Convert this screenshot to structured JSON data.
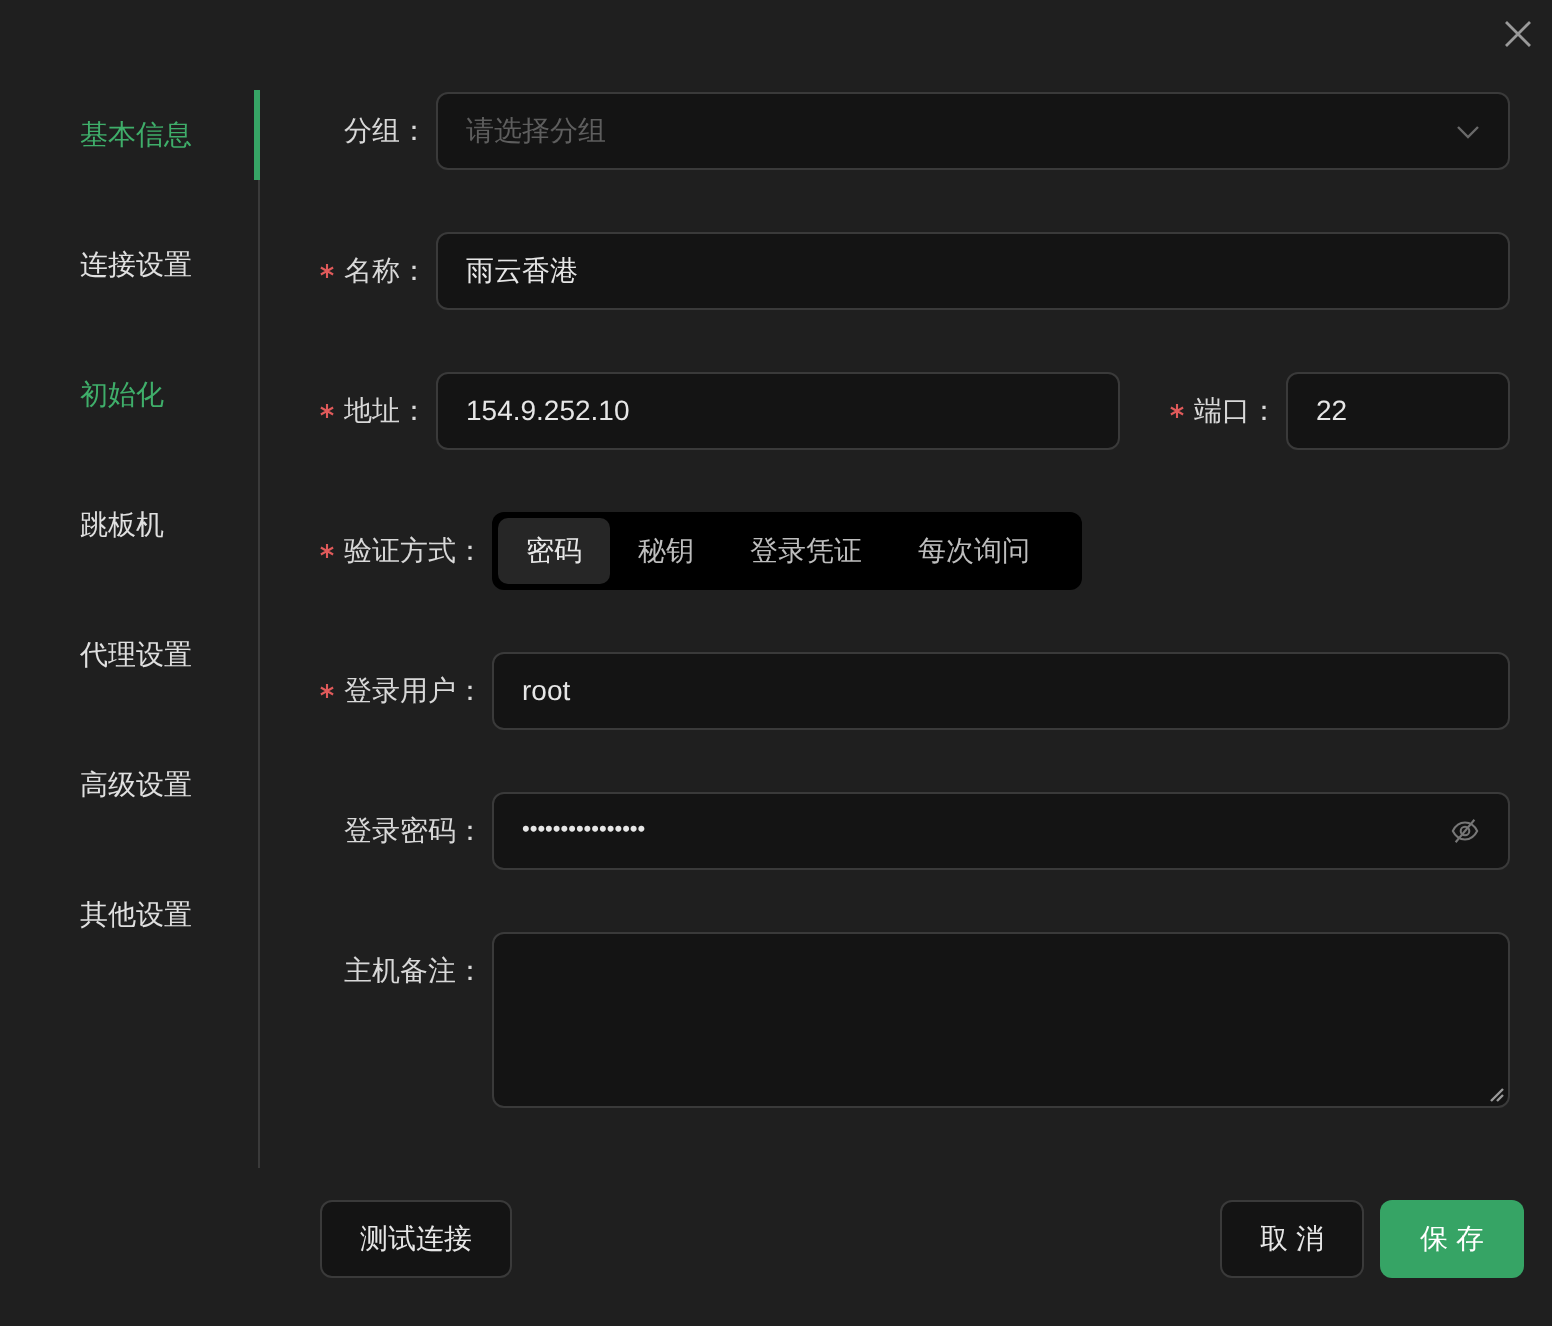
{
  "sidebar": {
    "items": [
      {
        "label": "基本信息",
        "selected": true,
        "highlighted": true
      },
      {
        "label": "连接设置",
        "selected": false,
        "highlighted": false
      },
      {
        "label": "初始化",
        "selected": false,
        "highlighted": true
      },
      {
        "label": "跳板机",
        "selected": false,
        "highlighted": false
      },
      {
        "label": "代理设置",
        "selected": false,
        "highlighted": false
      },
      {
        "label": "高级设置",
        "selected": false,
        "highlighted": false
      },
      {
        "label": "其他设置",
        "selected": false,
        "highlighted": false
      }
    ]
  },
  "form": {
    "rows": [
      {
        "fields": [
          {
            "kind": "select",
            "label": "分组：",
            "required": false,
            "placeholder": "请选择分组"
          }
        ]
      },
      {
        "fields": [
          {
            "kind": "text",
            "label": "名称：",
            "required": true,
            "value": "雨云香港"
          }
        ]
      },
      {
        "fields": [
          {
            "kind": "text",
            "label": "地址：",
            "required": true,
            "value": "154.9.252.10"
          },
          {
            "kind": "port",
            "label": "端口：",
            "required": true,
            "value": "22"
          }
        ]
      },
      {
        "fields": [
          {
            "kind": "segmented",
            "label": "验证方式：",
            "required": true,
            "options": [
              {
                "label": "密码",
                "selected": true
              },
              {
                "label": "秘钥",
                "selected": false
              },
              {
                "label": "登录凭证",
                "selected": false
              },
              {
                "label": "每次询问",
                "selected": false
              }
            ]
          }
        ]
      },
      {
        "fields": [
          {
            "kind": "text",
            "label": "登录用户：",
            "required": true,
            "value": "root"
          }
        ]
      },
      {
        "fields": [
          {
            "kind": "password",
            "label": "登录密码：",
            "required": false,
            "value": "••••••••••••••••"
          }
        ]
      },
      {
        "fields": [
          {
            "kind": "textarea",
            "label": "主机备注：",
            "required": false
          }
        ]
      }
    ]
  },
  "footer": {
    "left_buttons": [
      {
        "label": "测试连接",
        "kind": "default"
      }
    ],
    "right_buttons": [
      {
        "label": "取 消",
        "kind": "default"
      },
      {
        "label": "保 存",
        "kind": "primary"
      }
    ]
  }
}
